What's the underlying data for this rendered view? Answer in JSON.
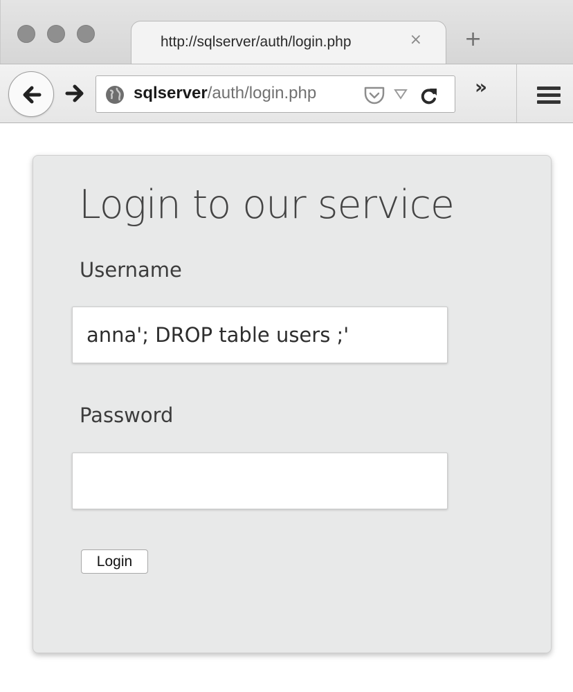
{
  "browser": {
    "tab": {
      "title": "http://sqlserver/auth/login.php",
      "close_icon": "×",
      "close_icon_name": "close-icon"
    },
    "new_tab_icon": "+",
    "new_tab_icon_name": "plus-icon",
    "nav": {
      "back_icon": "arrow-left-icon",
      "forward_icon": "arrow-right-icon",
      "reload_icon": "reload-icon",
      "overflow_icon": "»",
      "menu_icon": "hamburger-menu-icon"
    },
    "url": {
      "host": "sqlserver",
      "path": "/auth/login.php",
      "site_icon": "globe-icon",
      "pocket_icon": "pocket-icon",
      "dropdown_icon": "dropdown-triangle-icon"
    }
  },
  "form": {
    "heading": "Login to our service",
    "username_label": "Username",
    "username_value": "anna'; DROP table users ;'",
    "password_label": "Password",
    "password_value": "",
    "login_button": "Login"
  }
}
